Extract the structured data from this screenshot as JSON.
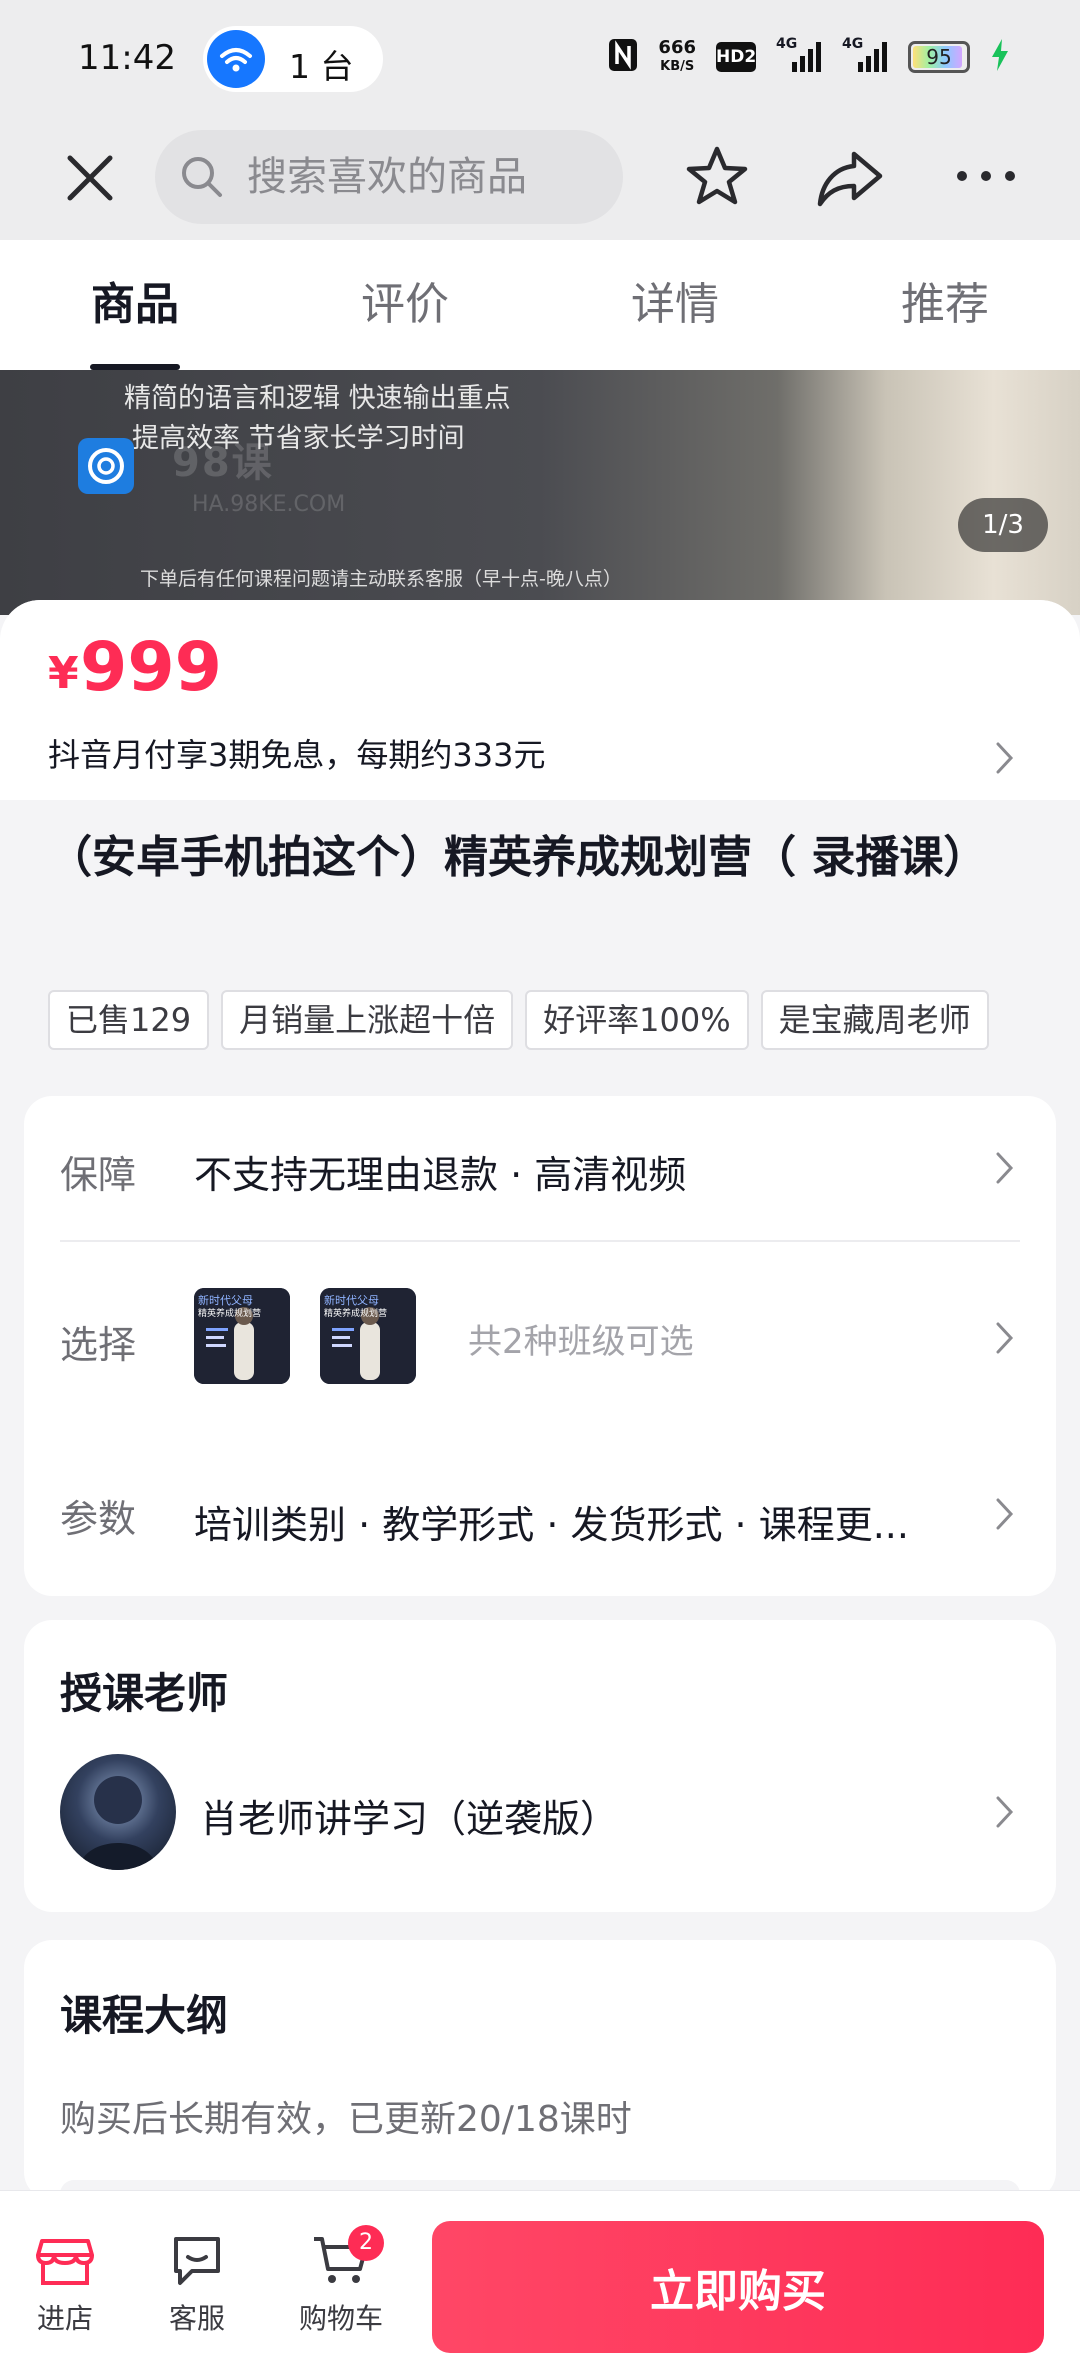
{
  "status_bar": {
    "time": "11:42",
    "device_count": "1 台",
    "net_speed_value": "666",
    "net_speed_unit": "KB/S",
    "hd_badge": "HD2",
    "signal_1": "4G",
    "signal_2": "4G",
    "battery": "95",
    "battery_level": 0.95,
    "wifi_color": "#1677ff"
  },
  "nav": {
    "search_placeholder": "搜索喜欢的商品"
  },
  "tabs": [
    {
      "label": "商品",
      "active": true
    },
    {
      "label": "评价",
      "active": false
    },
    {
      "label": "详情",
      "active": false
    },
    {
      "label": "推荐",
      "active": false
    }
  ],
  "banner": {
    "line1": "精简的语言和逻辑 快速输出重点",
    "line2": "提高效率 节省家长学习时间",
    "watermark": "98课",
    "watermark_url": "HA.98KE.COM",
    "footer": "下单后有任何课程问题请主动联系客服（早十点-晚八点）",
    "counter": "1/3"
  },
  "price": {
    "currency": "¥",
    "value": "999",
    "installment": "抖音月付享3期免息，每期约333元",
    "accent_color": "#fe2c55"
  },
  "product": {
    "title": "（安卓手机拍这个）精英养成规划营（ 录播课）",
    "tags": [
      "已售129",
      "月销量上涨超十倍",
      "好评率100%",
      "是宝藏周老师"
    ]
  },
  "info": {
    "guarantee_label": "保障",
    "guarantee_text": "不支持无理由退款 · 高清视频",
    "choose_label": "选择",
    "choose_hint": "共2种班级可选",
    "thumb_caption": "新时代父母",
    "thumb_subcaption": "精英养成规划营",
    "params_label": "参数",
    "params_text": "培训类别 · 教学形式 · 发货形式 · 课程更..."
  },
  "teacher": {
    "section_title": "授课老师",
    "name": "肖老师讲学习（逆袭版）"
  },
  "syllabus": {
    "section_title": "课程大纲",
    "subtitle": "购买后长期有效，已更新20/18课时"
  },
  "bottom_bar": {
    "store_label": "进店",
    "service_label": "客服",
    "cart_label": "购物车",
    "cart_badge": "2",
    "buy_label": "立即购买"
  }
}
